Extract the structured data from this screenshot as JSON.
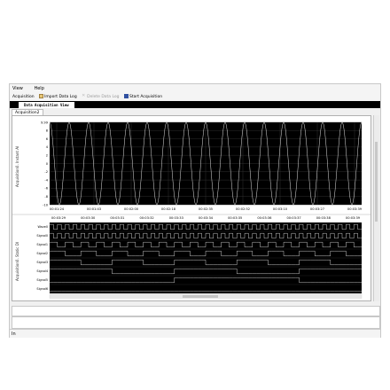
{
  "menu": {
    "items": [
      "View",
      "Help"
    ]
  },
  "toolbar": {
    "acquisition_label": "Acquisition",
    "import_label": "Import Data Log",
    "delete_label": "Delete Data Log",
    "start_label": "Start Acquisition"
  },
  "tabs": {
    "main_tab": "Data Acquisition View",
    "sub_tab": "Acquisition2"
  },
  "waveform": {
    "ylabel": "Acquisition0. Instant AI",
    "y_ticks": [
      "9.99",
      "8",
      "6",
      "4",
      "2",
      "0",
      "-2",
      "-4",
      "-6",
      "-8",
      "-10"
    ],
    "x_ticks": [
      "00:01:24",
      "00:01:43",
      "00:02:00",
      "00:02:18",
      "00:02:35",
      "00:02:52",
      "00:03:10",
      "00:03:27",
      "00:03:39"
    ]
  },
  "digital": {
    "ylabel": "Acquisition0. Static DI",
    "x_ticks": [
      "00:03:29",
      "00:03:30",
      "00:03:31",
      "00:03:32",
      "00:03:33",
      "00:03:34",
      "00:03:35",
      "00:03:36",
      "00:03:37",
      "00:03:38",
      "00:03:39"
    ],
    "signals": [
      "Wave0",
      "Signal0",
      "Signal1",
      "Signal2",
      "Signal3",
      "Signal4",
      "Signal5",
      "Signal6"
    ]
  },
  "statusbar": {
    "label": "In"
  },
  "colors": {
    "plot_bg": "#000000",
    "trace": "#ffffff",
    "grid": "#3a3a3a",
    "tab_bar": "#000000"
  },
  "chart_data": [
    {
      "type": "line",
      "title": "",
      "ylabel": "Acquisition0. Instant AI",
      "xlabel": "",
      "ylim": [
        -10,
        9.99
      ],
      "x_categories": [
        "00:01:24",
        "00:01:43",
        "00:02:00",
        "00:02:18",
        "00:02:35",
        "00:02:52",
        "00:03:10",
        "00:03:27",
        "00:03:39"
      ],
      "series": [
        {
          "shape": "sine",
          "amplitude": 9.99,
          "offset": 0,
          "cycles": 16
        }
      ],
      "grid": true
    },
    {
      "type": "line",
      "title": "",
      "ylabel": "Acquisition0. Static DI",
      "xlabel": "",
      "x_categories": [
        "00:03:29",
        "00:03:30",
        "00:03:31",
        "00:03:32",
        "00:03:33",
        "00:03:34",
        "00:03:35",
        "00:03:36",
        "00:03:37",
        "00:03:38",
        "00:03:39"
      ],
      "series": [
        {
          "name": "Wave0",
          "bits": [
            1,
            0,
            1,
            0,
            1,
            0,
            1,
            0,
            1,
            0,
            1,
            0,
            1,
            0,
            1,
            0,
            1,
            0,
            1,
            0,
            1,
            0,
            1,
            0,
            1,
            0,
            1,
            0,
            1,
            0,
            1,
            0,
            1,
            0,
            1,
            0,
            1,
            0,
            1,
            0,
            1,
            0,
            1,
            0,
            1,
            0,
            1,
            0,
            1,
            0,
            1,
            0,
            1,
            0,
            1,
            0,
            1,
            0,
            1,
            0,
            1,
            0,
            1,
            0,
            1,
            0,
            1,
            0,
            1,
            0,
            1,
            0,
            1,
            0,
            1,
            0,
            1,
            0,
            1,
            0
          ]
        },
        {
          "name": "Signal0",
          "bits": [
            1,
            0,
            1,
            0,
            1,
            0,
            1,
            0,
            1,
            0,
            1,
            0,
            1,
            0,
            1,
            0,
            1,
            0,
            1,
            0,
            1,
            0,
            1,
            0,
            1,
            0,
            1,
            0,
            1,
            0,
            1,
            0,
            1,
            0,
            1,
            0,
            1,
            0,
            1,
            0,
            1,
            0,
            1,
            0,
            1,
            0,
            1,
            0,
            1,
            0,
            1,
            0,
            1,
            0,
            1,
            0,
            1,
            0,
            1,
            0,
            1,
            0,
            1,
            0,
            1,
            0,
            1,
            0,
            1,
            0,
            1,
            0,
            1,
            0,
            1,
            0,
            1,
            0,
            1,
            0
          ]
        },
        {
          "name": "Signal1",
          "bits": [
            1,
            1,
            0,
            0,
            1,
            1,
            0,
            0,
            1,
            1,
            0,
            0,
            1,
            1,
            0,
            0,
            1,
            1,
            0,
            0,
            1,
            1,
            0,
            0,
            1,
            1,
            0,
            0,
            1,
            1,
            0,
            0,
            1,
            1,
            0,
            0,
            1,
            1,
            0,
            0,
            1,
            1,
            0,
            0,
            1,
            1,
            0,
            0,
            1,
            1,
            0,
            0,
            1,
            1,
            0,
            0,
            1,
            1,
            0,
            0,
            1,
            1,
            0,
            0,
            1,
            1,
            0,
            0,
            1,
            1,
            0,
            0,
            1,
            1,
            0,
            0,
            1,
            1,
            0,
            0
          ]
        },
        {
          "name": "Signal2",
          "bits": [
            1,
            1,
            1,
            1,
            0,
            0,
            0,
            0,
            1,
            1,
            1,
            1,
            0,
            0,
            0,
            0,
            1,
            1,
            1,
            1,
            0,
            0,
            0,
            0,
            1,
            1,
            1,
            1,
            0,
            0,
            0,
            0,
            1,
            1,
            1,
            1,
            0,
            0,
            0,
            0,
            1,
            1,
            1,
            1,
            0,
            0,
            0,
            0,
            1,
            1,
            1,
            1,
            0,
            0,
            0,
            0,
            1,
            1,
            1,
            1,
            0,
            0,
            0,
            0,
            1,
            1,
            1,
            1,
            0,
            0,
            0,
            0,
            1,
            1,
            1,
            1,
            0,
            0,
            0,
            0
          ]
        },
        {
          "name": "Signal3",
          "bits": [
            1,
            1,
            1,
            1,
            1,
            1,
            1,
            1,
            0,
            0,
            0,
            0,
            0,
            0,
            0,
            0,
            1,
            1,
            1,
            1,
            1,
            1,
            1,
            1,
            0,
            0,
            0,
            0,
            0,
            0,
            0,
            0,
            1,
            1,
            1,
            1,
            1,
            1,
            1,
            1,
            0,
            0,
            0,
            0,
            0,
            0,
            0,
            0,
            1,
            1,
            1,
            1,
            1,
            1,
            1,
            1,
            0,
            0,
            0,
            0,
            0,
            0,
            0,
            0,
            1,
            1,
            1,
            1,
            1,
            1,
            1,
            1,
            0,
            0,
            0,
            0,
            0,
            0,
            0,
            0
          ]
        },
        {
          "name": "Signal4",
          "bits": [
            1,
            1,
            1,
            1,
            1,
            1,
            1,
            1,
            1,
            1,
            1,
            1,
            1,
            1,
            1,
            1,
            0,
            0,
            0,
            0,
            0,
            0,
            0,
            0,
            0,
            0,
            0,
            0,
            0,
            0,
            0,
            0,
            1,
            1,
            1,
            1,
            1,
            1,
            1,
            1,
            1,
            1,
            1,
            1,
            1,
            1,
            1,
            1,
            0,
            0,
            0,
            0,
            0,
            0,
            0,
            0,
            0,
            0,
            0,
            0,
            0,
            0,
            0,
            0,
            1,
            1,
            1,
            1,
            1,
            1,
            1,
            1,
            1,
            1,
            1,
            1,
            1,
            1,
            1,
            1
          ]
        },
        {
          "name": "Signal5",
          "bits": [
            0,
            0,
            0,
            0,
            0,
            0,
            0,
            0,
            0,
            0,
            0,
            0,
            0,
            0,
            0,
            0,
            0,
            0,
            0,
            0,
            0,
            0,
            0,
            0,
            0,
            0,
            0,
            0,
            0,
            0,
            0,
            0,
            1,
            1,
            1,
            1,
            1,
            1,
            1,
            1,
            1,
            1,
            1,
            1,
            1,
            1,
            1,
            1,
            1,
            1,
            1,
            1,
            1,
            1,
            1,
            1,
            1,
            1,
            1,
            1,
            1,
            1,
            1,
            1,
            0,
            0,
            0,
            0,
            0,
            0,
            0,
            0,
            0,
            0,
            0,
            0,
            0,
            0,
            0,
            0
          ]
        },
        {
          "name": "Signal6",
          "bits": [
            0,
            0,
            0,
            0,
            0,
            0,
            0,
            0,
            0,
            0,
            0,
            0,
            0,
            0,
            0,
            0,
            0,
            0,
            0,
            0,
            0,
            0,
            0,
            0,
            0,
            0,
            0,
            0,
            0,
            0,
            0,
            0,
            0,
            0,
            0,
            0,
            0,
            0,
            0,
            0,
            0,
            0,
            0,
            0,
            0,
            0,
            0,
            0,
            0,
            0,
            0,
            0,
            0,
            0,
            0,
            0,
            0,
            0,
            0,
            0,
            0,
            0,
            0,
            0,
            0,
            0,
            0,
            0,
            0,
            0,
            0,
            0,
            0,
            0,
            0,
            0,
            0,
            0,
            0,
            0
          ]
        }
      ]
    }
  ]
}
